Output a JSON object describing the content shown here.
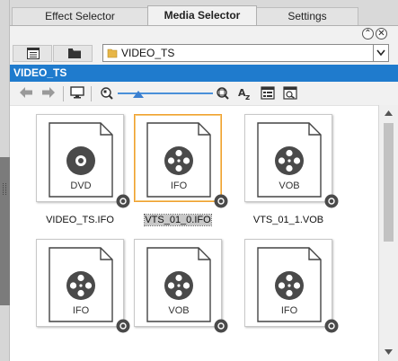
{
  "tabs": [
    {
      "label": "Effect Selector",
      "active": false
    },
    {
      "label": "Media Selector",
      "active": true
    },
    {
      "label": "Settings",
      "active": false
    }
  ],
  "window_controls": {
    "collapse_glyph": "⌃",
    "close_glyph": "✕"
  },
  "path": {
    "value": "VIDEO_TS"
  },
  "folder_header": "VIDEO_TS",
  "toolbar": {
    "icons": [
      "back-arrow-icon",
      "forward-arrow-icon",
      "monitor-icon",
      "zoom-out-icon",
      "zoom-in-icon",
      "sort-az-icon",
      "details-view-icon",
      "preview-icon"
    ]
  },
  "files": [
    {
      "type_label": "DVD",
      "name": "VIDEO_TS.IFO",
      "icon": "disc-icon",
      "selected": false
    },
    {
      "type_label": "IFO",
      "name": "VTS_01_0.IFO",
      "icon": "film-reel-icon",
      "selected": true
    },
    {
      "type_label": "VOB",
      "name": "VTS_01_1.VOB",
      "icon": "film-reel-icon",
      "selected": false
    },
    {
      "type_label": "IFO",
      "name": "",
      "icon": "film-reel-icon",
      "selected": false
    },
    {
      "type_label": "VOB",
      "name": "",
      "icon": "film-reel-icon",
      "selected": false
    },
    {
      "type_label": "IFO",
      "name": "",
      "icon": "film-reel-icon",
      "selected": false
    }
  ],
  "colors": {
    "header_blue": "#1f7bcd",
    "selection_orange": "#f0a030",
    "slider_blue": "#3b7fd0"
  }
}
